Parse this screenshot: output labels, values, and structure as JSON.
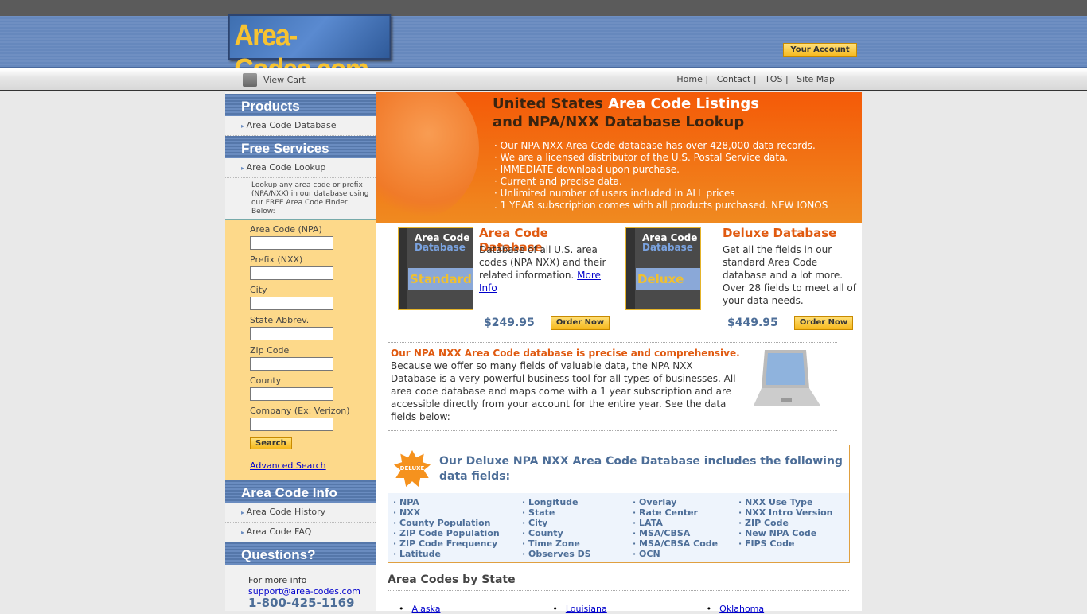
{
  "header": {
    "logo": "Area-Codes.com",
    "account_button": "Your Account"
  },
  "nav": {
    "view_cart": "View Cart",
    "links": [
      "Home",
      "Contact",
      "TOS",
      "Site Map"
    ]
  },
  "sidebar": {
    "products": {
      "title": "Products",
      "items": [
        "Area Code Database"
      ]
    },
    "free_services": {
      "title": "Free Services",
      "items": [
        "Area Code Lookup"
      ],
      "description": "Lookup any area code or prefix (NPA/NXX) in our database using our FREE Area Code Finder Below:"
    },
    "form": {
      "fields": [
        "Area Code (NPA)",
        "Prefix (NXX)",
        "City",
        "State Abbrev.",
        "Zip Code",
        "County",
        "Company (Ex: Verizon)"
      ],
      "search_button": "Search",
      "advanced_link": "Advanced Search"
    },
    "info": {
      "title": "Area Code Info",
      "items": [
        "Area Code History",
        "Area Code FAQ"
      ]
    },
    "questions": {
      "title": "Questions?",
      "text": "For more info",
      "email": "support@area-codes.com",
      "phone": "1-800-425-1169"
    }
  },
  "banner": {
    "title_dark1": "United States ",
    "title_light": "Area Code Listings",
    "title_dark2": "and NPA/NXX Database Lookup",
    "bullets": [
      "· Our NPA NXX Area Code database has over 428,000 data records.",
      "· We are a licensed distributor of the U.S. Postal Service data.",
      "· IMMEDIATE download upon purchase.",
      "· Current and precise data.",
      "· Unlimited number of users included in ALL prices",
      ". 1 YEAR subscription comes with all products purchased. NEW IONOS"
    ]
  },
  "products": [
    {
      "box_title": "Area Code",
      "box_sub": "Database",
      "box_edition": "Standard",
      "title": "Area Code Database",
      "desc": "Database of all U.S. area codes (NPA NXX) and their related information. ",
      "link": "More Info",
      "price": "$249.95",
      "button": "Order Now"
    },
    {
      "box_title": "Area Code",
      "box_sub": "Database",
      "box_edition": "Deluxe",
      "title": "Deluxe Database",
      "desc": "Get all the fields in our standard Area Code database and a lot more. Over 28 fields to meet all of your data needs.",
      "price": "$449.95",
      "button": "Order Now"
    }
  ],
  "precise": {
    "title": "Our NPA NXX Area Code database is precise and comprehensive.",
    "body": "Because we offer so many fields of valuable data, the NPA NXX Database is a very powerful business tool for all types of businesses. All area code database and maps come with a 1 year subscription and are accessible directly from your account for the entire year. See the data fields below:"
  },
  "fields_box": {
    "badge": "DELUXE",
    "title": "Our Deluxe NPA NXX Area Code Database includes the following data fields:",
    "columns": [
      [
        "NPA",
        "NXX",
        "County Population",
        "ZIP Code Population",
        "ZIP Code Frequency",
        "Latitude"
      ],
      [
        "Longitude",
        "State",
        "City",
        "County",
        "Time Zone",
        "Observes DS"
      ],
      [
        "Overlay",
        "Rate Center",
        "LATA",
        "MSA/CBSA",
        "MSA/CBSA Code",
        "OCN"
      ],
      [
        "NXX Use Type",
        "NXX Intro Version",
        "ZIP Code",
        "New NPA Code",
        "FIPS Code"
      ]
    ]
  },
  "states": {
    "title": "Area Codes by State",
    "items": [
      "Alaska",
      "Louisiana",
      "Oklahoma"
    ]
  }
}
